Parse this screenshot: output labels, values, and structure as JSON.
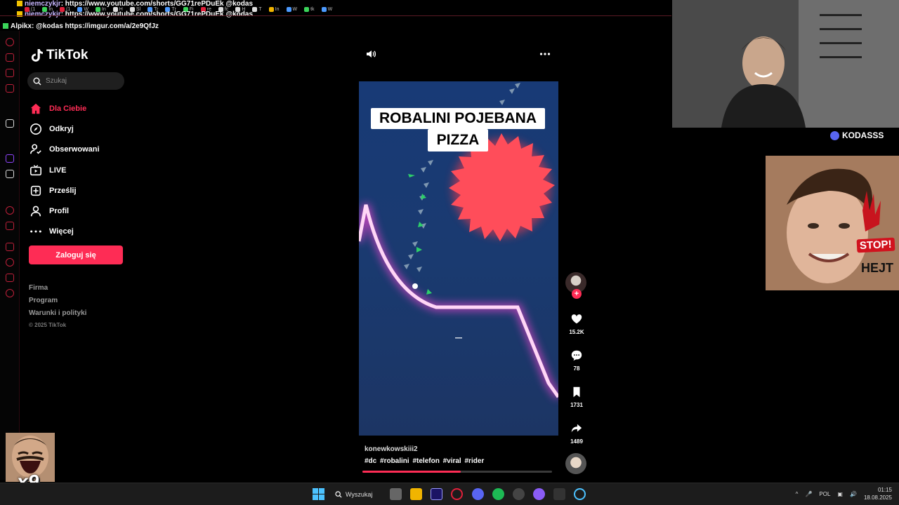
{
  "chat": [
    {
      "user": "niemczykjr",
      "message": ": https://www.youtube.com/shorts/GG71rePDuEk @kodas"
    },
    {
      "user": "niemczykjr",
      "message": ": https://www.youtube.com/shorts/GG71rePDuEk @kodas"
    },
    {
      "user": "Alpikx",
      "message": ": @kodas https://imgur.com/a/2e9QfJz"
    }
  ],
  "browser_tabs": [
    "(1",
    "In",
    "(1",
    "W",
    "In",
    "H",
    "Sl",
    "Tr",
    "Tr",
    "Fi",
    "re",
    "fc",
    "H",
    "T",
    "In",
    "W",
    "tk",
    "W"
  ],
  "tiktok": {
    "logo": "TikTok",
    "search_placeholder": "Szukaj",
    "nav": [
      {
        "label": "Dla Ciebie",
        "icon": "home-icon",
        "active": true
      },
      {
        "label": "Odkryj",
        "icon": "compass-icon",
        "active": false
      },
      {
        "label": "Obserwowani",
        "icon": "following-icon",
        "active": false
      },
      {
        "label": "LIVE",
        "icon": "live-icon",
        "active": false
      },
      {
        "label": "Prześlij",
        "icon": "upload-icon",
        "active": false
      },
      {
        "label": "Profil",
        "icon": "profile-icon",
        "active": false
      },
      {
        "label": "Więcej",
        "icon": "more-icon",
        "active": false
      }
    ],
    "login_label": "Zaloguj się",
    "footer": [
      "Firma",
      "Program",
      "Warunki i polityki"
    ],
    "copyright": "© 2025 TikTok",
    "accent": "#fe2c55"
  },
  "video": {
    "caption_line1": "ROBALINI POJEBANA",
    "caption_line2": "PIZZA",
    "author": "konewkowskiii2",
    "hashtags": "#dc #robalini #telefon #viral #rider",
    "progress_fraction": 0.52,
    "likes": "15.2K",
    "comments": "78",
    "saves": "1731",
    "shares": "1489"
  },
  "overlay": {
    "discord_name": "KODASSS",
    "stop_text": "STOP!",
    "hejt_text": "HEJT",
    "emote_count": "x9"
  },
  "taskbar": {
    "search_label": "Wyszukaj",
    "language": "POL",
    "time": "01:15",
    "date": "18.08.2025"
  }
}
